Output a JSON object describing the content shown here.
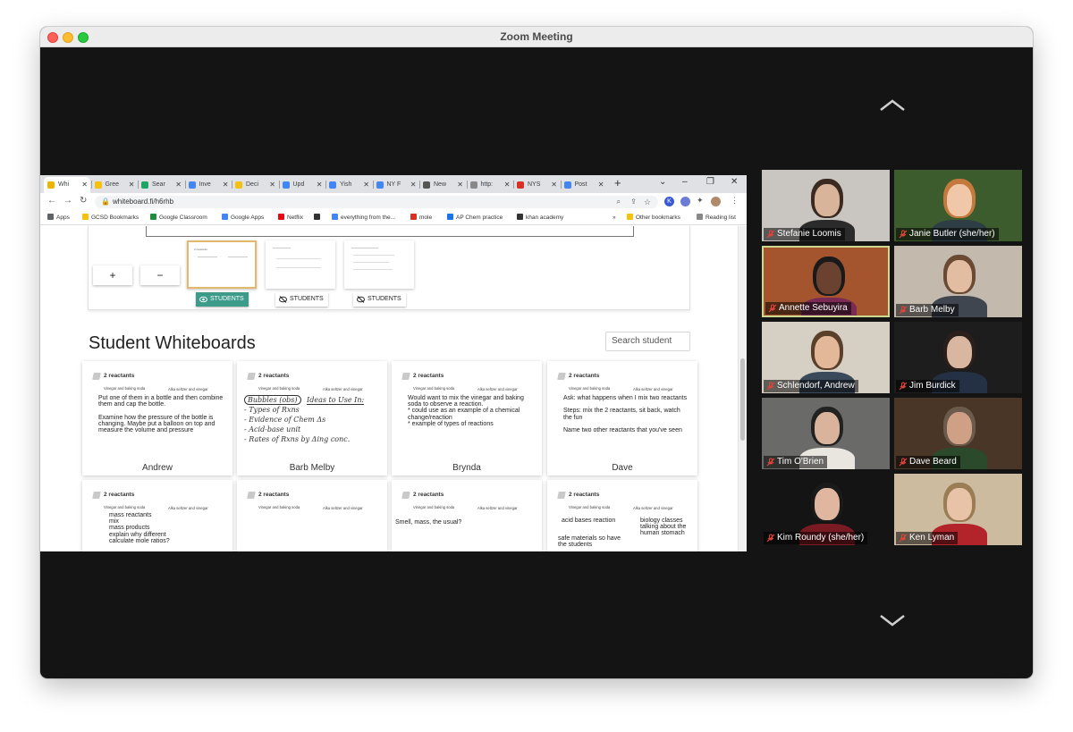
{
  "window": {
    "title": "Zoom Meeting"
  },
  "browser": {
    "tabs": [
      {
        "label": "Whi",
        "active": true,
        "color": "#f0b400"
      },
      {
        "label": "Gree",
        "color": "#f4c20d"
      },
      {
        "label": "Sear",
        "color": "#1fa463"
      },
      {
        "label": "Inve",
        "color": "#4285f4"
      },
      {
        "label": "Deci",
        "color": "#f4c20d"
      },
      {
        "label": "Upd",
        "color": "#4285f4"
      },
      {
        "label": "Yish",
        "color": "#4285f4"
      },
      {
        "label": "NY F",
        "color": "#4285f4"
      },
      {
        "label": "New",
        "color": "#555555"
      },
      {
        "label": "http:",
        "color": "#888888"
      },
      {
        "label": "NYS",
        "color": "#d93025"
      },
      {
        "label": "Post",
        "color": "#4285f4"
      }
    ],
    "new_tab_label": "+",
    "url": "whiteboard.fi/h6rhb",
    "bookmarks": [
      {
        "label": "Apps",
        "color": "#5f6368"
      },
      {
        "label": "GCSD Bookmarks",
        "color": "#f4c20d"
      },
      {
        "label": "Google Classroom",
        "color": "#1e8e3e"
      },
      {
        "label": "Google Apps",
        "color": "#4285f4"
      },
      {
        "label": "Netflix",
        "color": "#e50914"
      },
      {
        "label": "",
        "color": "#333333"
      },
      {
        "label": "everything from the...",
        "color": "#4285f4"
      },
      {
        "label": "mole",
        "color": "#d93025"
      },
      {
        "label": "AP Chem practice",
        "color": "#1a73e8"
      },
      {
        "label": "khan academy",
        "color": "#333333"
      }
    ],
    "other_bookmarks": "Other bookmarks",
    "reading_list": "Reading list"
  },
  "whiteboard": {
    "zoom_in": "+",
    "zoom_out": "−",
    "thumb_caption": "2 reactants",
    "student_buttons": [
      "STUDENTS",
      "STUDENTS",
      "STUDENTS"
    ],
    "section_title": "Student Whiteboards",
    "search_placeholder": "Search student",
    "cards": [
      {
        "head": "2 reactants",
        "sub1": "Vinegar and baking soda",
        "sub2": "Alka seltzer and vinegar",
        "body": "Put one of them in a bottle and then combine them and cap the bottle.\n\nExamine how the pressure of the bottle is changing.  Maybe put a  balloon on top and measure the volume and pressure",
        "name": "Andrew"
      },
      {
        "head": "2 reactants",
        "sub1": "Vinegar and baking soda",
        "sub2": "Alka seltzer and vinegar",
        "body": "",
        "name": "Barb Melby"
      },
      {
        "head": "2 reactants",
        "sub1": "Vinegar and baking soda",
        "sub2": "Alka seltzer and vinegar",
        "body": "Would want to mix the vinegar and baking soda to observe a reaction.\n* could use as an example of a chemical change/reaction\n* example of types of reactions",
        "name": "Brynda"
      },
      {
        "head": "2 reactants",
        "sub1": "Vinegar and baking soda",
        "sub2": "Alka seltzer and vinegar",
        "body": "Ask: what happens when I mix two reactants\n\nSteps: mix the 2 reactants, sit back, watch the fun\n\nName two other reactants that you've seen",
        "name": "Dave"
      },
      {
        "head": "2 reactants",
        "sub1": "Vinegar and baking soda",
        "sub2": "Alka seltzer and vinegar",
        "body": "mass reactants\nmix\nmass products\nexplain why different\ncalculate mole ratios?",
        "name": ""
      },
      {
        "head": "2 reactants",
        "sub1": "Vinegar and baking soda",
        "sub2": "Alka seltzer and vinegar",
        "body": "",
        "name": ""
      },
      {
        "head": "2 reactants",
        "sub1": "Vinegar and baking soda",
        "sub2": "Alka seltzer and vinegar",
        "body": "Smell, mass, the usual?",
        "name": ""
      },
      {
        "head": "2 reactants",
        "sub1": "Vinegar and baking soda",
        "sub2": "Alka seltzer and vinegar",
        "body": "",
        "name": ""
      }
    ],
    "barb_handwriting": {
      "left_box": "Bubbles (obs)",
      "right": "Ideas to Use In:",
      "lines": [
        "- Types of Rxns",
        "- Evidence of Chem Δs",
        "- Acid-base unit",
        "- Rates of Rxns by Δing conc."
      ]
    },
    "dave_extra": {
      "left": "acid bases reaction",
      "right": "biology classes talking about the human stomach",
      "bottom": "safe materials so have the students"
    }
  },
  "participants": [
    {
      "name": "Stefanie Loomis",
      "bg": "#c9c6c1",
      "skin": "#d8b49a",
      "hair": "#3a2a22",
      "shirt": "#2b2b2b"
    },
    {
      "name": "Janie Butler (she/her)",
      "bg": "#3d5c2e",
      "skin": "#f0c7a8",
      "hair": "#c47a3c",
      "shirt": "#2e3e44"
    },
    {
      "name": "Annette Sebuyira",
      "bg": "#a4552e",
      "skin": "#6b4230",
      "hair": "#1a1a1a",
      "shirt": "#7a2a55",
      "active": true
    },
    {
      "name": "Barb Melby",
      "bg": "#c3b9ad",
      "skin": "#e3bda2",
      "hair": "#6a4a33",
      "shirt": "#404650"
    },
    {
      "name": "Schlendorf, Andrew",
      "bg": "#d6cfc4",
      "skin": "#e2b898",
      "hair": "#5a3f2a",
      "shirt": "#3b4a5a"
    },
    {
      "name": "Jim Burdick",
      "bg": "#1d1d1d",
      "skin": "#d9b6a0",
      "hair": "#2a1f1a",
      "shirt": "#243044"
    },
    {
      "name": "Tim O'Brien",
      "bg": "#6a6a68",
      "skin": "#d9b39b",
      "hair": "#222222",
      "shirt": "#e9e6e0"
    },
    {
      "name": "Dave Beard",
      "bg": "#4a3626",
      "skin": "#cf9f86",
      "hair": "#6b5b4d",
      "shirt": "#2b4a2b"
    },
    {
      "name": "Kim Roundy (she/her)",
      "bg": "#141414",
      "skin": "#e0b6a0",
      "hair": "#1a1a1a",
      "shirt": "#7a1a22"
    },
    {
      "name": "Ken Lyman",
      "bg": "#cdbba0",
      "skin": "#e9c3a8",
      "hair": "#9a7c55",
      "shirt": "#b3242a"
    }
  ]
}
